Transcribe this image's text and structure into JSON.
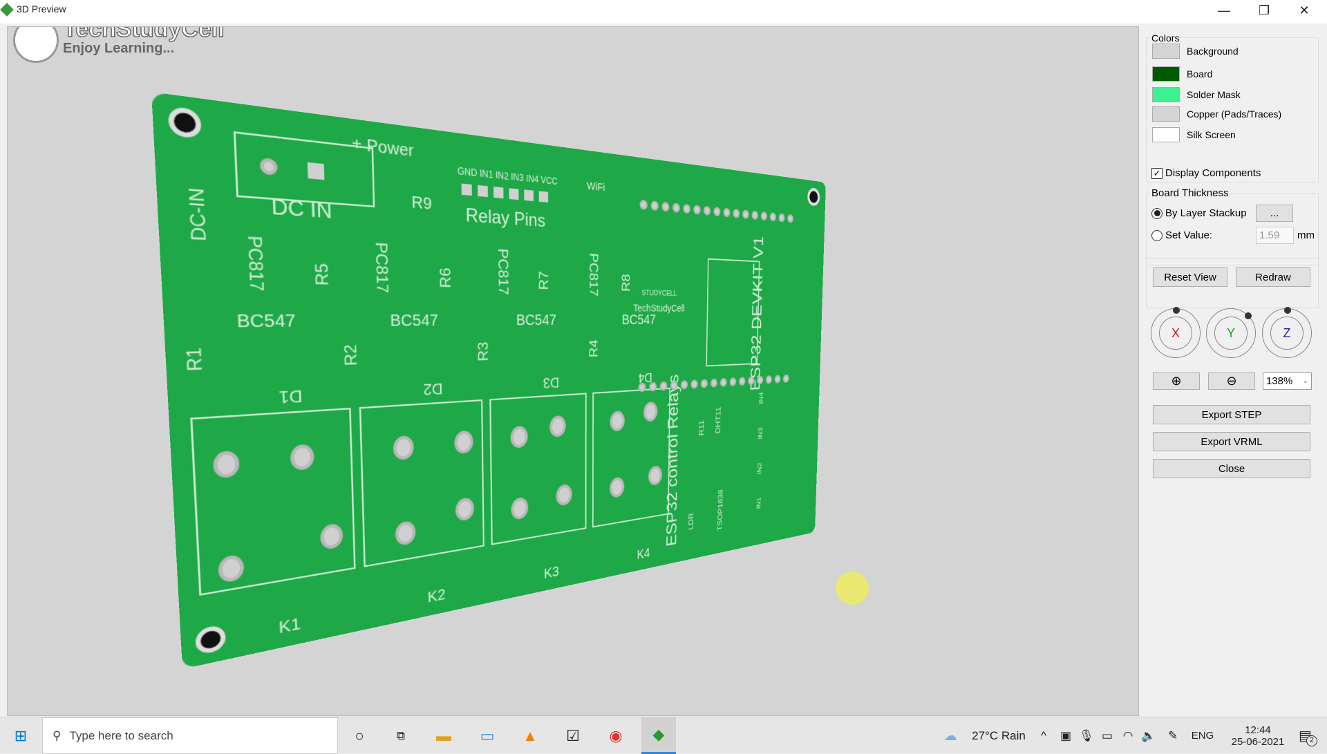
{
  "window": {
    "title": "3D Preview",
    "minimize": "—",
    "restore": "❐",
    "close": "✕"
  },
  "watermark": {
    "brand": "TechStudyCell",
    "tagline": "Enjoy Learning...",
    "logo_text": "STUDYCELL"
  },
  "pcb": {
    "colors": {
      "board": "#1fa847",
      "silk": "#d8f0dc"
    },
    "labels": {
      "dcin": "DC-IN",
      "power": "+ Power",
      "dc_in": "DC  IN",
      "relay_pins": "Relay Pins",
      "pins": "GND IN1 IN2 IN3 IN4 VCC",
      "r9": "R9",
      "wifi": "WiFi",
      "esp": "ESP32 DEVKIT V1",
      "pc817": "PC817",
      "r5": "R5",
      "r6": "R6",
      "r7": "R7",
      "r8": "R8",
      "bc547": "BC547",
      "r1": "R1",
      "r2": "R2",
      "r3": "R3",
      "r4": "R4",
      "d1": "D1",
      "d2": "D2",
      "d3": "D3",
      "d4": "D4",
      "k1": "K1",
      "k2": "K2",
      "k3": "K3",
      "k4": "K4",
      "title": "ESP32 control Relays",
      "brand": "TechStudyCell",
      "studycell": "STUDYCELL",
      "dht": "DHT11",
      "ldr": "LDR",
      "tsop": "TSOP1838",
      "r11": "R11",
      "in1": "IN1",
      "in2": "IN2",
      "in3": "IN3",
      "in4": "IN4"
    }
  },
  "panel": {
    "colors_title": "Colors",
    "colors": [
      {
        "label": "Background",
        "color": "#d4d4d4"
      },
      {
        "label": "Board",
        "color": "#005a00"
      },
      {
        "label": "Solder Mask",
        "color": "#40f090"
      },
      {
        "label": "Copper (Pads/Traces)",
        "color": "#d4d4d4"
      },
      {
        "label": "Silk Screen",
        "color": "#ffffff"
      }
    ],
    "display_components": {
      "label": "Display Components",
      "checked": true
    },
    "thickness_title": "Board Thickness",
    "by_layer": {
      "label": "By Layer Stackup",
      "selected": true,
      "button": "..."
    },
    "set_value": {
      "label": "Set Value:",
      "value": "1.59",
      "unit": "mm"
    },
    "reset_view": "Reset View",
    "redraw": "Redraw",
    "dials": [
      {
        "label": "X",
        "color": "#d02020"
      },
      {
        "label": "Y",
        "color": "#20a020"
      },
      {
        "label": "Z",
        "color": "#2020a0"
      }
    ],
    "zoom": "138%",
    "export_step": "Export STEP",
    "export_vrml": "Export VRML",
    "close": "Close"
  },
  "taskbar": {
    "search_placeholder": "Type here to search",
    "weather": "27°C  Rain",
    "lang": "ENG",
    "time": "12:44",
    "date": "25-06-2021",
    "notifications": "2"
  }
}
